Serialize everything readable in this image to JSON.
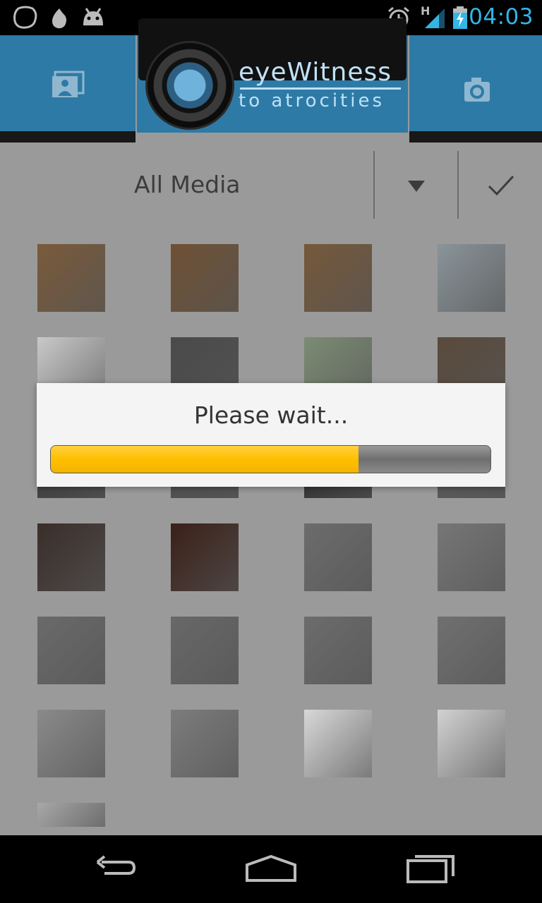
{
  "status_bar": {
    "time": "04:03",
    "network_type": "H",
    "icons": [
      "notification-bubble-icon",
      "flame-app-icon",
      "android-debug-icon",
      "alarm-icon",
      "signal-icon",
      "battery-charging-icon"
    ],
    "accent_color": "#33b5e5"
  },
  "header": {
    "logo_line1": "eyeWitness",
    "logo_line2": "to atrocities",
    "left_tab_icon": "gallery-view-icon",
    "right_tab_icon": "camera-icon",
    "brand_color": "#2e7aa6"
  },
  "filter": {
    "label": "All Media",
    "dropdown_icon": "dropdown-triangle-icon",
    "confirm_icon": "checkmark-icon"
  },
  "gallery": {
    "thumbnail_count": 25,
    "thumbnail_colors": [
      "#7a5a3a",
      "#6f5034",
      "#76583a",
      "#8a949a",
      "#c9c9c9",
      "#4a4a4a",
      "#7c8c74",
      "#5a4a3c",
      "#3a3a3a",
      "#4e4e4e",
      "#2a2a2a",
      "#5a5a5a",
      "#3a2e2a",
      "#3a2018",
      "#6c6c6c",
      "#767676",
      "#6a6a6a",
      "#686868",
      "#6c6c6c",
      "#707070",
      "#8a8a8a",
      "#7c7c7c",
      "#d8d8d8",
      "#d2d2d2",
      "#a8a8a8"
    ]
  },
  "dialog": {
    "message": "Please wait...",
    "progress_fraction": 0.7,
    "progress_color": "#ffbf00"
  },
  "nav": {
    "back_icon": "back-icon",
    "home_icon": "home-icon",
    "recents_icon": "recent-apps-icon"
  }
}
